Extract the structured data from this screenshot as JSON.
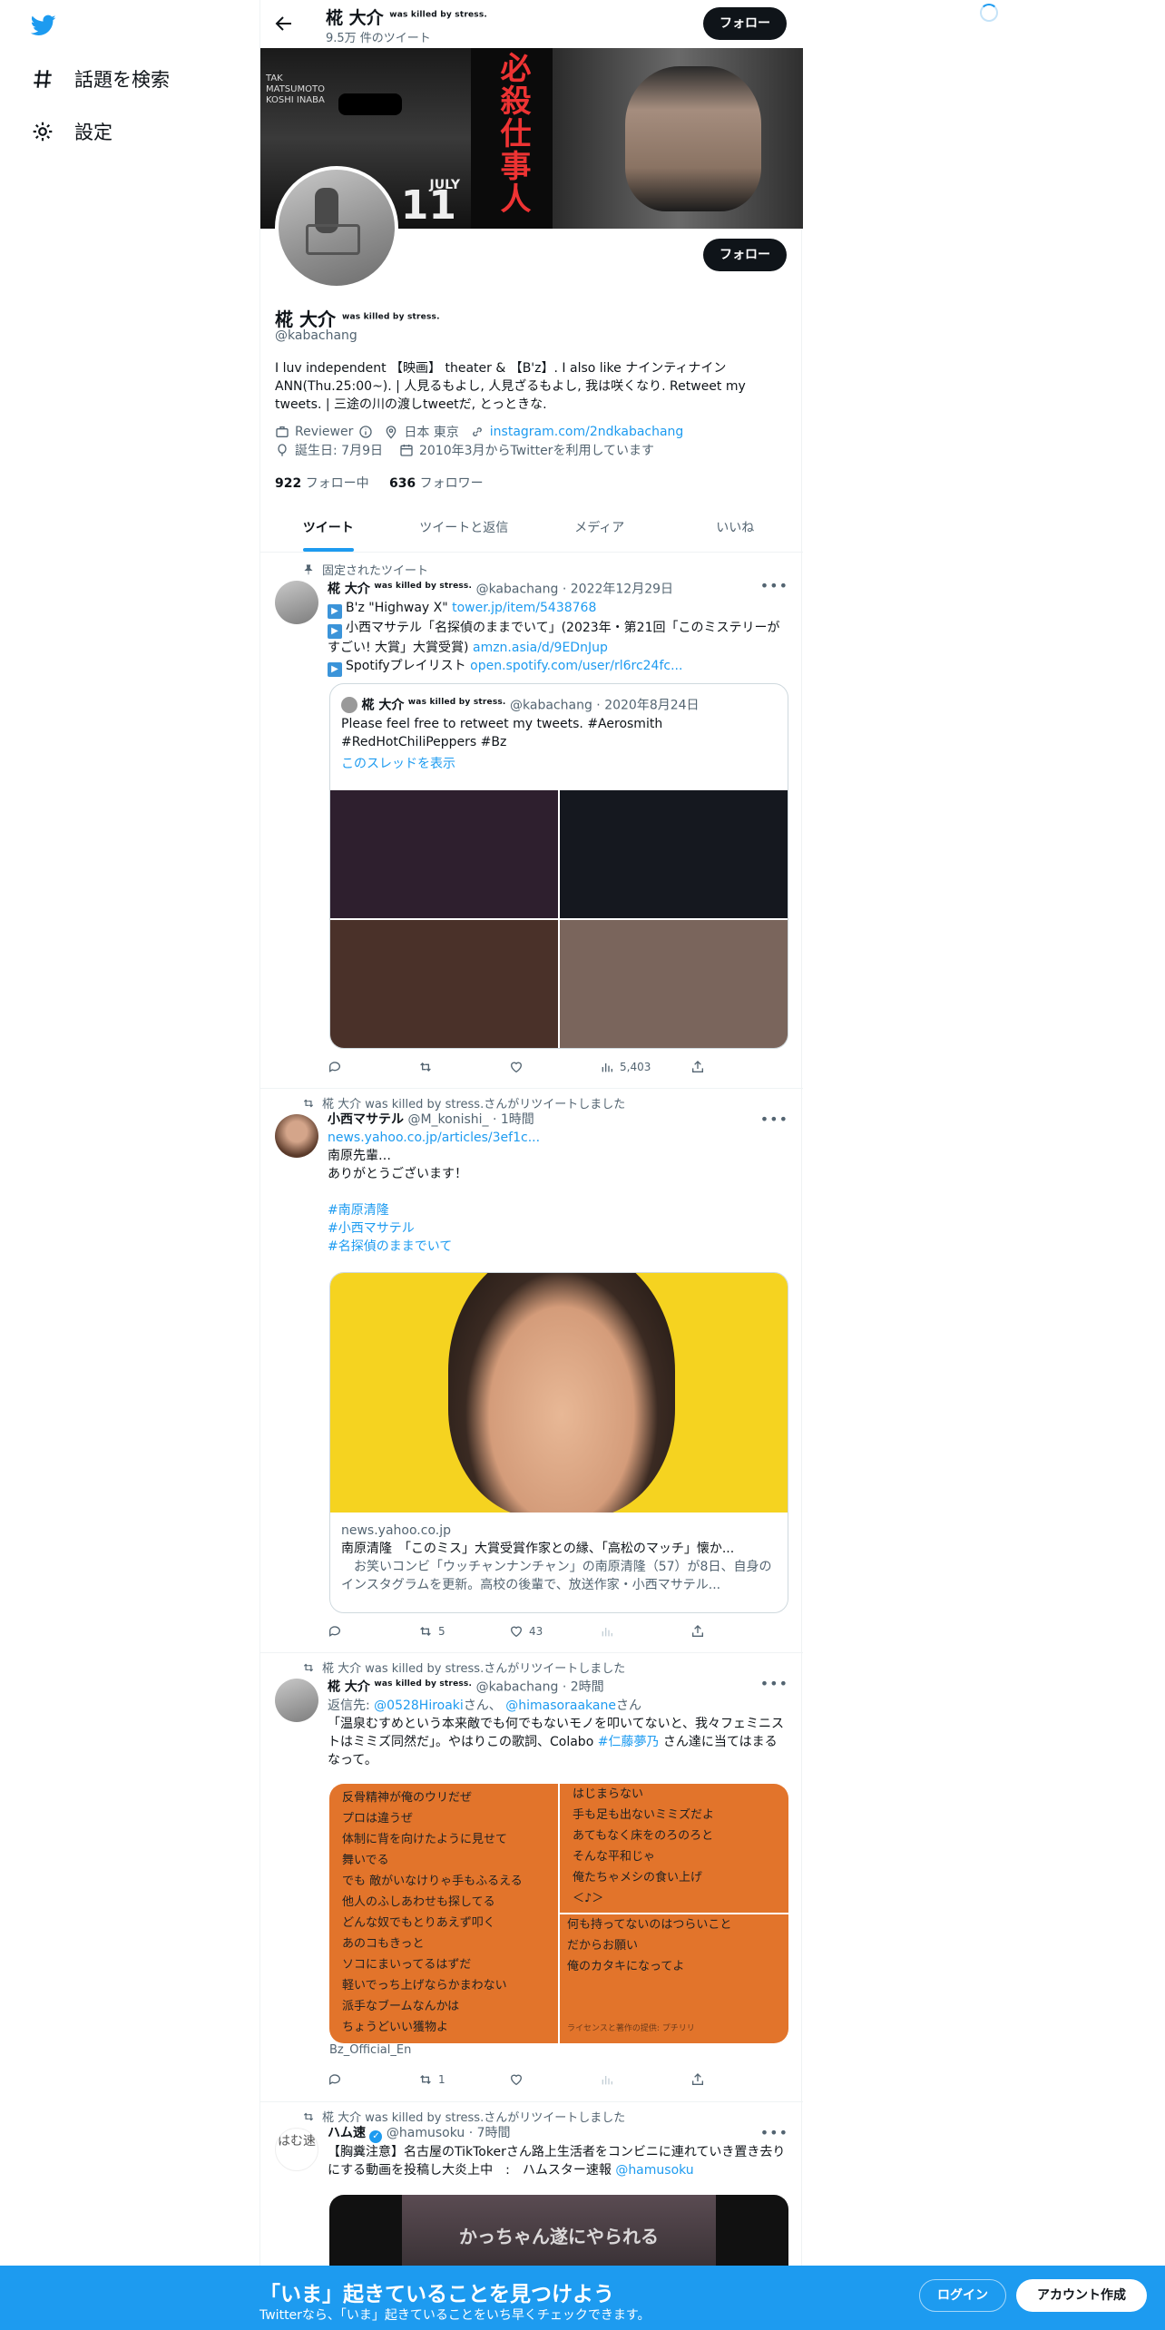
{
  "nav": {
    "items": [
      {
        "label": "話題を検索",
        "icon": "hash-icon"
      },
      {
        "label": "設定",
        "icon": "gear-icon"
      }
    ]
  },
  "header": {
    "name": "椛 大介",
    "name_suffix": "was killed by stress.",
    "tweet_count": "9.5万 件のツイート",
    "follow_label": "フォロー"
  },
  "banner": {
    "left_text": "TAK MATSUMOTO KOSHI INABA",
    "kanji": "必殺仕事人",
    "month": "JULY",
    "day": "11"
  },
  "profile": {
    "name": "椛 大介",
    "name_suffix": "was killed by stress.",
    "handle": "@kabachang",
    "follow_label": "フォロー",
    "bio": "I luv independent 【映画】 theater & 【B'z】. I also like ナインティナイン ANN(Thu.25:00~). | 人見るもよし, 人見ざるもよし, 我は咲くなり. Retweet my tweets. | 三途の川の渡しtweetだ, とっときな.",
    "category": "Reviewer",
    "location": "日本 東京",
    "link": "instagram.com/2ndkabachang",
    "birthday": "誕生日: 7月9日",
    "joined": "2010年3月からTwitterを利用しています",
    "following_count": "922",
    "following_label": "フォロー中",
    "followers_count": "636",
    "followers_label": "フォロワー"
  },
  "tabs": [
    "ツイート",
    "ツイートと返信",
    "メディア",
    "いいね"
  ],
  "tweets": [
    {
      "context": "固定されたツイート",
      "name": "椛 大介",
      "name_suffix": "was killed by stress.",
      "handle": "@kabachang",
      "time": "2022年12月29日",
      "lines": [
        {
          "text": "B'z \"Highway X\"",
          "link": "tower.jp/item/5438768"
        },
        {
          "text": "小西マサテル「名探偵のままでいて」(2023年・第21回「このミステリーがすごい! 大賞」大賞受賞)",
          "link": "amzn.asia/d/9EDnJup"
        },
        {
          "text": "Spotifyプレイリスト",
          "link": "open.spotify.com/user/rl6rc24fc..."
        }
      ],
      "quote": {
        "name": "椛 大介",
        "name_suffix": "was killed by stress.",
        "handle": "@kabachang",
        "time": "2020年8月24日",
        "text": "Please feel free to retweet my tweets. #Aerosmith #RedHotChiliPeppers #Bz",
        "show_thread": "このスレッドを表示",
        "colors": [
          "#2e1f2e",
          "#15181f",
          "#4a3129",
          "#7a655c"
        ]
      },
      "views": "5,403"
    },
    {
      "context": "椛 大介 was killed by stress.さんがリツイートしました",
      "name": "小西マサテル",
      "handle": "@M_konishi_",
      "time": "1時間",
      "link": "news.yahoo.co.jp/articles/3ef1c...",
      "text1": "南原先輩…",
      "text2": "ありがとうございます！",
      "hashtags": [
        "#南原清隆",
        "#小西マサテル",
        "#名探偵のままでいて"
      ],
      "card": {
        "domain": "news.yahoo.co.jp",
        "title": "南原清隆　「このミス」大賞受賞作家との縁、「高松のマッチ」懐か...",
        "desc": "　お笑いコンビ「ウッチャンナンチャン」の南原清隆（57）が8日、自身のインスタグラムを更新。高校の後輩で、放送作家・小西マサテル..."
      },
      "retweets": "5",
      "likes": "43"
    },
    {
      "context": "椛 大介 was killed by stress.さんがリツイートしました",
      "name": "椛 大介",
      "name_suffix": "was killed by stress.",
      "handle": "@kabachang",
      "time": "2時間",
      "reply_prefix": "返信先:",
      "reply_to1": "@0528Hiroaki",
      "reply_mid": "さん、",
      "reply_to2": "@himasoraakane",
      "reply_suffix": "さん",
      "text_a": "「温泉むすめという本来敵でも何でもないモノを叩いてないと、我々フェミニストはミミズ同然だ」。やはりこの歌詞、Colabo",
      "text_tag": "#仁藤夢乃",
      "text_b": "さん達に当てはまるなって。",
      "lyrics_left": [
        "反骨精神が俺のウリだぜ",
        "プロは違うぜ",
        "体制に背を向けたように見せて",
        "舞いでる",
        "でも 敵がいなけりゃ手もふるえる",
        "他人のふしあわせも探してる",
        "どんな奴でもとりあえず叩く",
        "あのコもきっと",
        "ソコにまいってるはずだ",
        "軽いでっち上げならかまわない",
        "派手なブームなんかは",
        "ちょうどいい獲物よ"
      ],
      "lyrics_right_top": [
        "はじまらない",
        "手も足も出ないミミズだよ",
        "あてもなく床をのろのろと",
        "そんな平和じゃ",
        "俺たちゃメシの食い上げ",
        "＜♪＞"
      ],
      "lyrics_right_bottom": [
        "何も持ってないのはつらいこと",
        "だからお願い",
        "俺のカタキになってよ"
      ],
      "credit": "ライセンスと著作の提供: プチリリ",
      "source": "Bz_Official_En",
      "retweets": "1"
    },
    {
      "context": "椛 大介 was killed by stress.さんがリツイートしました",
      "name": "ハム速",
      "handle": "@hamusoku",
      "time": "7時間",
      "text": "【胸糞注意】名古屋のTikTokerさん路上生活者をコンビニに連れていき置き去りにする動画を投稿し大炎上中　:　ハムスター速報",
      "link": "@hamusoku",
      "avatar_text": "はむ速",
      "image_caption": "かっちゃん遂にやられる"
    }
  ],
  "bottom": {
    "title": "「いま」起きていることを見つけよう",
    "subtitle": "Twitterなら、「いま」起きていることをいち早くチェックできます。",
    "login": "ログイン",
    "signup": "アカウント作成"
  },
  "colors": {
    "accent": "#1d9bf0",
    "text": "#0f1419",
    "muted": "#536471",
    "lyrics_bg": "#e2742b"
  }
}
